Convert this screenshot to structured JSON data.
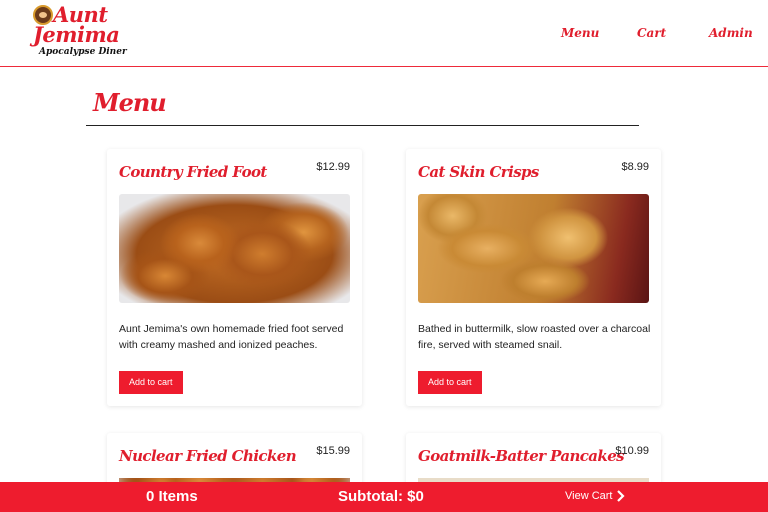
{
  "logo": {
    "line1": "Aunt",
    "line2": "Jemima",
    "line3": "Apocalypse Diner"
  },
  "nav": {
    "menu": "Menu",
    "cart": "Cart",
    "admin": "Admin"
  },
  "page": {
    "title": "Menu"
  },
  "items": [
    {
      "name": "Country Fried Foot",
      "price": "$12.99",
      "description": "Aunt Jemima's own homemade fried foot served with creamy mashed and ionized peaches.",
      "button": "Add to cart",
      "image": "fried-chicken-photo"
    },
    {
      "name": "Cat Skin Crisps",
      "price": "$8.99",
      "description": "Bathed in buttermilk, slow roasted over a charcoal fire, served with steamed snail.",
      "button": "Add to cart",
      "image": "potato-chips-photo"
    },
    {
      "name": "Nuclear Fried Chicken",
      "price": "$15.99",
      "image": "fried-chicken-photo"
    },
    {
      "name": "Goatmilk-Batter Pancakes",
      "price": "$10.99",
      "image": "pancakes-photo"
    }
  ],
  "cart_bar": {
    "items": "0 Items",
    "subtotal": "Subtotal: $0",
    "view": "View Cart",
    "view_icon": "chevron-right-icon"
  },
  "colors": {
    "brand_red": "#ee1c2e"
  }
}
